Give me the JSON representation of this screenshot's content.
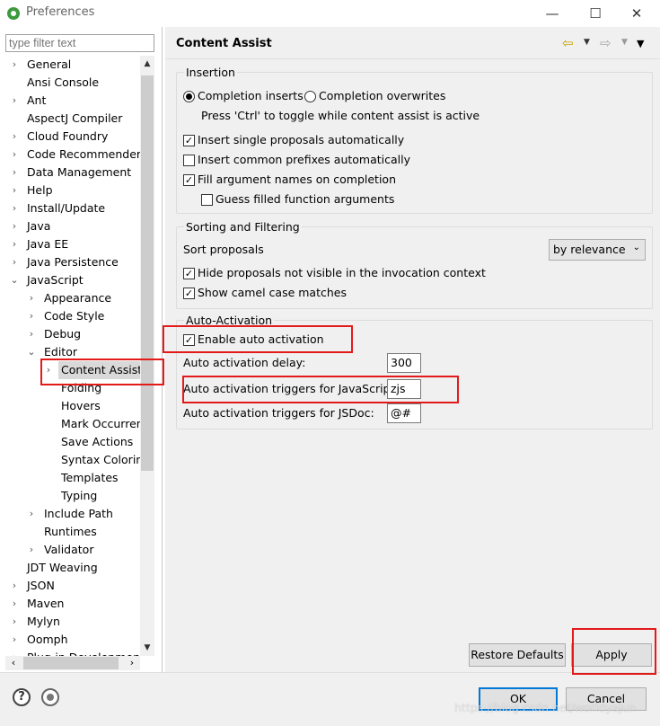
{
  "window": {
    "title": "Preferences",
    "minimize_glyph": "—",
    "maximize_glyph": "☐",
    "close_glyph": "✕"
  },
  "filter": {
    "placeholder": "type filter text"
  },
  "tree": {
    "items": [
      {
        "label": "General",
        "arrow": "›"
      },
      {
        "label": "Ansi Console",
        "arrow": ""
      },
      {
        "label": "Ant",
        "arrow": "›"
      },
      {
        "label": "AspectJ Compiler",
        "arrow": ""
      },
      {
        "label": "Cloud Foundry",
        "arrow": "›"
      },
      {
        "label": "Code Recommenders",
        "arrow": "›"
      },
      {
        "label": "Data Management",
        "arrow": "›"
      },
      {
        "label": "Help",
        "arrow": "›"
      },
      {
        "label": "Install/Update",
        "arrow": "›"
      },
      {
        "label": "Java",
        "arrow": "›"
      },
      {
        "label": "Java EE",
        "arrow": "›"
      },
      {
        "label": "Java Persistence",
        "arrow": "›"
      },
      {
        "label": "JavaScript",
        "arrow": "⌄"
      },
      {
        "label": "Appearance",
        "arrow": "›"
      },
      {
        "label": "Code Style",
        "arrow": "›"
      },
      {
        "label": "Debug",
        "arrow": "›"
      },
      {
        "label": "Editor",
        "arrow": "⌄"
      },
      {
        "label": "Content Assist",
        "arrow": "›"
      },
      {
        "label": "Folding",
        "arrow": ""
      },
      {
        "label": "Hovers",
        "arrow": ""
      },
      {
        "label": "Mark Occurrences",
        "arrow": ""
      },
      {
        "label": "Save Actions",
        "arrow": ""
      },
      {
        "label": "Syntax Coloring",
        "arrow": ""
      },
      {
        "label": "Templates",
        "arrow": ""
      },
      {
        "label": "Typing",
        "arrow": ""
      },
      {
        "label": "Include Path",
        "arrow": "›"
      },
      {
        "label": "Runtimes",
        "arrow": ""
      },
      {
        "label": "Validator",
        "arrow": "›"
      },
      {
        "label": "JDT Weaving",
        "arrow": ""
      },
      {
        "label": "JSON",
        "arrow": "›"
      },
      {
        "label": "Maven",
        "arrow": "›"
      },
      {
        "label": "Mylyn",
        "arrow": "›"
      },
      {
        "label": "Oomph",
        "arrow": "›"
      },
      {
        "label": "Plug-in Development",
        "arrow": "›"
      }
    ],
    "selected_index": 17
  },
  "page": {
    "title": "Content Assist"
  },
  "insertion": {
    "group_label": "Insertion",
    "radio_inserts": "Completion inserts",
    "radio_overwrites": "Completion overwrites",
    "toggle_hint": "Press 'Ctrl' to toggle while content assist is active",
    "cb_single_proposals": "Insert single proposals automatically",
    "cb_common_prefixes": "Insert common prefixes automatically",
    "cb_fill_argument_names": "Fill argument names on completion",
    "cb_guess_arguments": "Guess filled function arguments"
  },
  "sorting": {
    "group_label": "Sorting and Filtering",
    "sort_label": "Sort proposals",
    "sort_value": "by relevance",
    "cb_hide_not_visible": "Hide proposals not visible in the invocation context",
    "cb_camel_case": "Show camel case matches"
  },
  "auto_activation": {
    "group_label": "Auto-Activation",
    "cb_enable": "Enable auto activation",
    "delay_label": "Auto activation delay:",
    "delay_value": "300",
    "js_triggers_label": "Auto activation triggers for JavaScript:",
    "js_triggers_value": "zjs",
    "jsdoc_triggers_label": "Auto activation triggers for JSDoc:",
    "jsdoc_triggers_value": "@#"
  },
  "buttons": {
    "restore_defaults": "Restore Defaults",
    "apply": "Apply",
    "ok": "OK",
    "cancel": "Cancel"
  },
  "check": "✓",
  "watermark": "https://blog.csdn.net/worldyajun",
  "colors": {
    "highlight_red": "#e31a1a",
    "selection_bg": "#d9d9d9",
    "default_button_border": "#0078d7"
  }
}
